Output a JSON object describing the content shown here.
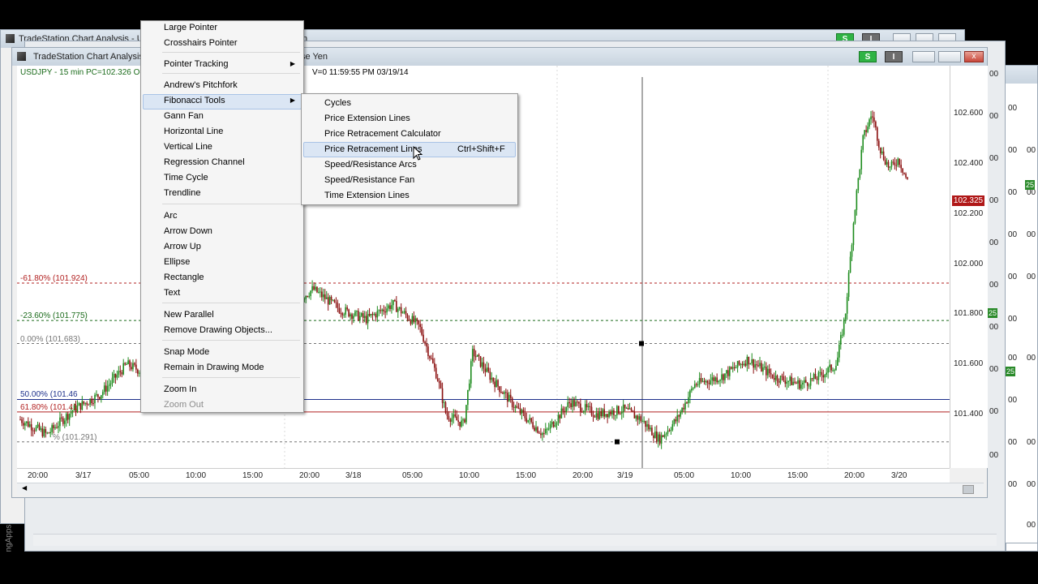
{
  "windows": {
    "back_title": "TradeStation Chart Analysis - US",
    "back_title_tail": "n",
    "front_title": "TradeStation Chart Analysis -",
    "front_title_tail": "se Yen",
    "badge_s": "S",
    "badge_i": "I",
    "close_glyph": "x"
  },
  "chart": {
    "status_left": "USDJPY - 15 min  PC=102.326  O=1",
    "status_right": "V=0  11:59:55 PM  03/19/14",
    "price_tag": "102.325",
    "y_labels": [
      "102.600",
      "102.400",
      "102.200",
      "102.000",
      "101.800",
      "101.600",
      "101.400"
    ],
    "x_labels": [
      "20:00",
      "3/17",
      "05:00",
      "10:00",
      "15:00",
      "20:00",
      "3/18",
      "05:00",
      "10:00",
      "15:00",
      "20:00",
      "3/19",
      "05:00",
      "10:00",
      "15:00",
      "20:00",
      "3/20"
    ],
    "fib_labels": [
      "-61.80% (101.924)",
      "-23.60% (101.775)",
      "0.00% (101.683)",
      "50.00% (101.46",
      "61.80% (101.41",
      "%  (101.291)"
    ],
    "right_partial": [
      "00",
      "00",
      "00",
      "00",
      "00",
      "00",
      "00",
      "00",
      "00",
      "00",
      "00",
      "00",
      "00",
      "00"
    ],
    "green_tags": [
      "25",
      "25",
      "25"
    ],
    "side_text": "ngApps"
  },
  "chart_data": {
    "type": "candlestick",
    "title": "USDJPY - 15 min",
    "x_ticks": [
      "20:00",
      "3/17",
      "05:00",
      "10:00",
      "15:00",
      "20:00",
      "3/18",
      "05:00",
      "10:00",
      "15:00",
      "20:00",
      "3/19",
      "05:00",
      "10:00",
      "15:00",
      "20:00",
      "3/20"
    ],
    "y_ticks": [
      102.6,
      102.4,
      102.2,
      102.0,
      101.8,
      101.6,
      101.4
    ],
    "ylim": [
      101.25,
      102.75
    ],
    "fibonacci_levels": [
      {
        "pct": "-61.80%",
        "price": 101.924
      },
      {
        "pct": "-23.60%",
        "price": 101.775
      },
      {
        "pct": "0.00%",
        "price": 101.683
      },
      {
        "pct": "50.00%",
        "price": 101.46
      },
      {
        "pct": "61.80%",
        "price": 101.41
      },
      {
        "pct": "100.00%",
        "price": 101.291
      }
    ],
    "price_path": [
      [
        0,
        101.38
      ],
      [
        0.03,
        101.32
      ],
      [
        0.06,
        101.42
      ],
      [
        0.09,
        101.48
      ],
      [
        0.12,
        101.6
      ],
      [
        0.15,
        101.55
      ],
      [
        0.3,
        101.82
      ],
      [
        0.33,
        101.9
      ],
      [
        0.36,
        101.82
      ],
      [
        0.39,
        101.78
      ],
      [
        0.42,
        101.84
      ],
      [
        0.45,
        101.75
      ],
      [
        0.47,
        101.55
      ],
      [
        0.48,
        101.4
      ],
      [
        0.5,
        101.36
      ],
      [
        0.51,
        101.65
      ],
      [
        0.53,
        101.55
      ],
      [
        0.56,
        101.42
      ],
      [
        0.59,
        101.32
      ],
      [
        0.62,
        101.45
      ],
      [
        0.65,
        101.4
      ],
      [
        0.68,
        101.42
      ],
      [
        0.7,
        101.38
      ],
      [
        0.72,
        101.3
      ],
      [
        0.74,
        101.38
      ],
      [
        0.76,
        101.52
      ],
      [
        0.79,
        101.55
      ],
      [
        0.82,
        101.62
      ],
      [
        0.85,
        101.55
      ],
      [
        0.88,
        101.52
      ],
      [
        0.9,
        101.55
      ],
      [
        0.92,
        101.6
      ],
      [
        0.93,
        101.8
      ],
      [
        0.94,
        102.2
      ],
      [
        0.95,
        102.5
      ],
      [
        0.96,
        102.6
      ],
      [
        0.97,
        102.45
      ],
      [
        0.98,
        102.38
      ],
      [
        0.99,
        102.42
      ],
      [
        1.0,
        102.33
      ]
    ],
    "last_price": 102.325
  },
  "menu": {
    "items": [
      {
        "label": "Large Pointer",
        "y": 0
      },
      {
        "label": "Crosshairs Pointer",
        "y": 1
      },
      {
        "label": "Pointer Tracking",
        "arrow": true
      },
      {
        "label": "Andrew's Pitchfork"
      },
      {
        "label": "Fibonacci Tools",
        "arrow": true,
        "highlight": true
      },
      {
        "label": "Gann Fan"
      },
      {
        "label": "Horizontal Line"
      },
      {
        "label": "Vertical Line"
      },
      {
        "label": "Regression Channel"
      },
      {
        "label": "Time Cycle"
      },
      {
        "label": "Trendline"
      },
      {
        "label": "Arc"
      },
      {
        "label": "Arrow Down"
      },
      {
        "label": "Arrow Up"
      },
      {
        "label": "Ellipse"
      },
      {
        "label": "Rectangle"
      },
      {
        "label": "Text"
      },
      {
        "label": "New Parallel"
      },
      {
        "label": "Remove Drawing Objects..."
      },
      {
        "label": "Snap Mode"
      },
      {
        "label": "Remain in Drawing Mode"
      },
      {
        "label": "Zoom In"
      },
      {
        "label": "Zoom Out",
        "disabled": true
      }
    ]
  },
  "submenu": {
    "items": [
      {
        "label": "Cycles"
      },
      {
        "label": "Price Extension Lines"
      },
      {
        "label": "Price Retracement Calculator"
      },
      {
        "label": "Price Retracement Lines",
        "shortcut": "Ctrl+Shift+F",
        "highlight": true
      },
      {
        "label": "Speed/Resistance Arcs"
      },
      {
        "label": "Speed/Resistance Fan"
      },
      {
        "label": "Time Extension Lines"
      }
    ]
  }
}
